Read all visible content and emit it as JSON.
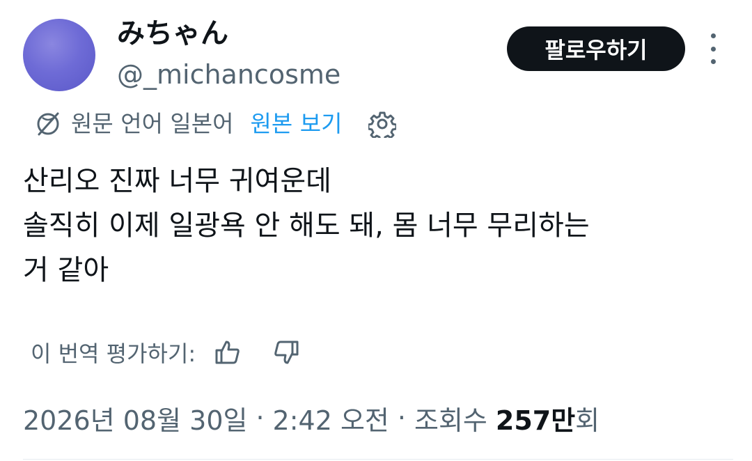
{
  "author": {
    "display_name": "みちゃん",
    "handle": "@_michancosme"
  },
  "actions": {
    "follow_label": "팔로우하기"
  },
  "translation": {
    "source_language": "원문 언어 일본어",
    "view_original_label": "원본 보기"
  },
  "tweet": {
    "lines": [
      "산리오 진짜 너무 귀여운데",
      "솔직히 이제 일광욕 안 해도 돼, 몸 너무 무리하는",
      "거 같아"
    ]
  },
  "rating": {
    "prompt": "이 번역 평가하기:"
  },
  "meta": {
    "date": "2026년 08월 30일",
    "separator": "·",
    "time": "2:42 오전",
    "views_label": "조회수",
    "views_number": "257만",
    "views_suffix": "회"
  },
  "colors": {
    "text": "#0f1419",
    "secondary": "#536471",
    "link": "#1d9bf0",
    "button_bg": "#0f1419",
    "avatar": "#6e6bd6"
  },
  "icons": [
    "translate-globe-icon",
    "gear-icon",
    "thumbs-up-icon",
    "thumbs-down-icon",
    "more-vertical-icon"
  ]
}
